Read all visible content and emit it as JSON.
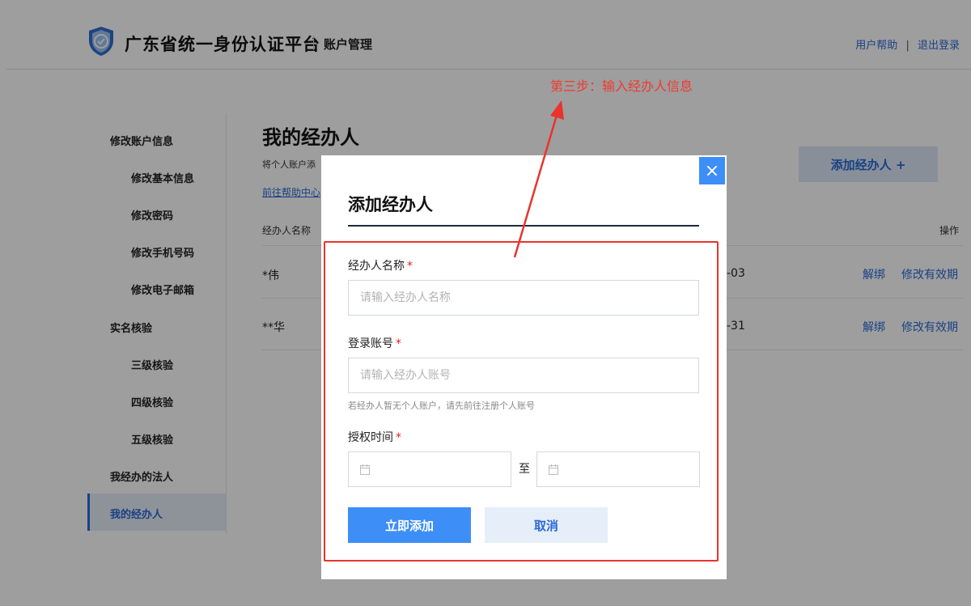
{
  "header": {
    "title": "广东省统一身份认证平台",
    "subtitle": "账户管理",
    "help_link": "用户帮助",
    "separator": "|",
    "logout_link": "退出登录"
  },
  "sidebar": {
    "items": [
      {
        "label": "修改账户信息",
        "level": 1
      },
      {
        "label": "修改基本信息",
        "level": 2
      },
      {
        "label": "修改密码",
        "level": 2
      },
      {
        "label": "修改手机号码",
        "level": 2
      },
      {
        "label": "修改电子邮箱",
        "level": 2
      },
      {
        "label": "实名核验",
        "level": 1
      },
      {
        "label": "三级核验",
        "level": 2
      },
      {
        "label": "四级核验",
        "level": 2
      },
      {
        "label": "五级核验",
        "level": 2
      },
      {
        "label": "我经办的法人",
        "level": 1
      },
      {
        "label": "我的经办人",
        "level": 1,
        "active": true
      }
    ]
  },
  "main": {
    "title": "我的经办人",
    "description": "将个人账户添",
    "help_link": "前往帮助中心",
    "add_button": "添加经办人 +",
    "table": {
      "col_name": "经办人名称",
      "col_ops": "操作",
      "rows": [
        {
          "name": "*伟",
          "date_tail": "-03",
          "unbind": "解绑",
          "modify": "修改有效期"
        },
        {
          "name": "**华",
          "date_tail": "-31",
          "unbind": "解绑",
          "modify": "修改有效期"
        }
      ]
    }
  },
  "modal": {
    "close": "×",
    "title": "添加经办人",
    "name_label": "经办人名称",
    "name_placeholder": "请输入经办人名称",
    "account_label": "登录账号",
    "account_placeholder": "请输入经办人账号",
    "account_hint": "若经办人暂无个人账户，请先前往注册个人账号",
    "time_label": "授权时间",
    "required_mark": "*",
    "date_separator": "至",
    "submit_button": "立即添加",
    "cancel_button": "取消"
  },
  "annotation": {
    "text": "第三步：输入经办人信息",
    "color": "#f03a2e"
  },
  "colors": {
    "accent": "#3d8ef7",
    "link": "#2a6ad6",
    "required": "#e02020"
  }
}
